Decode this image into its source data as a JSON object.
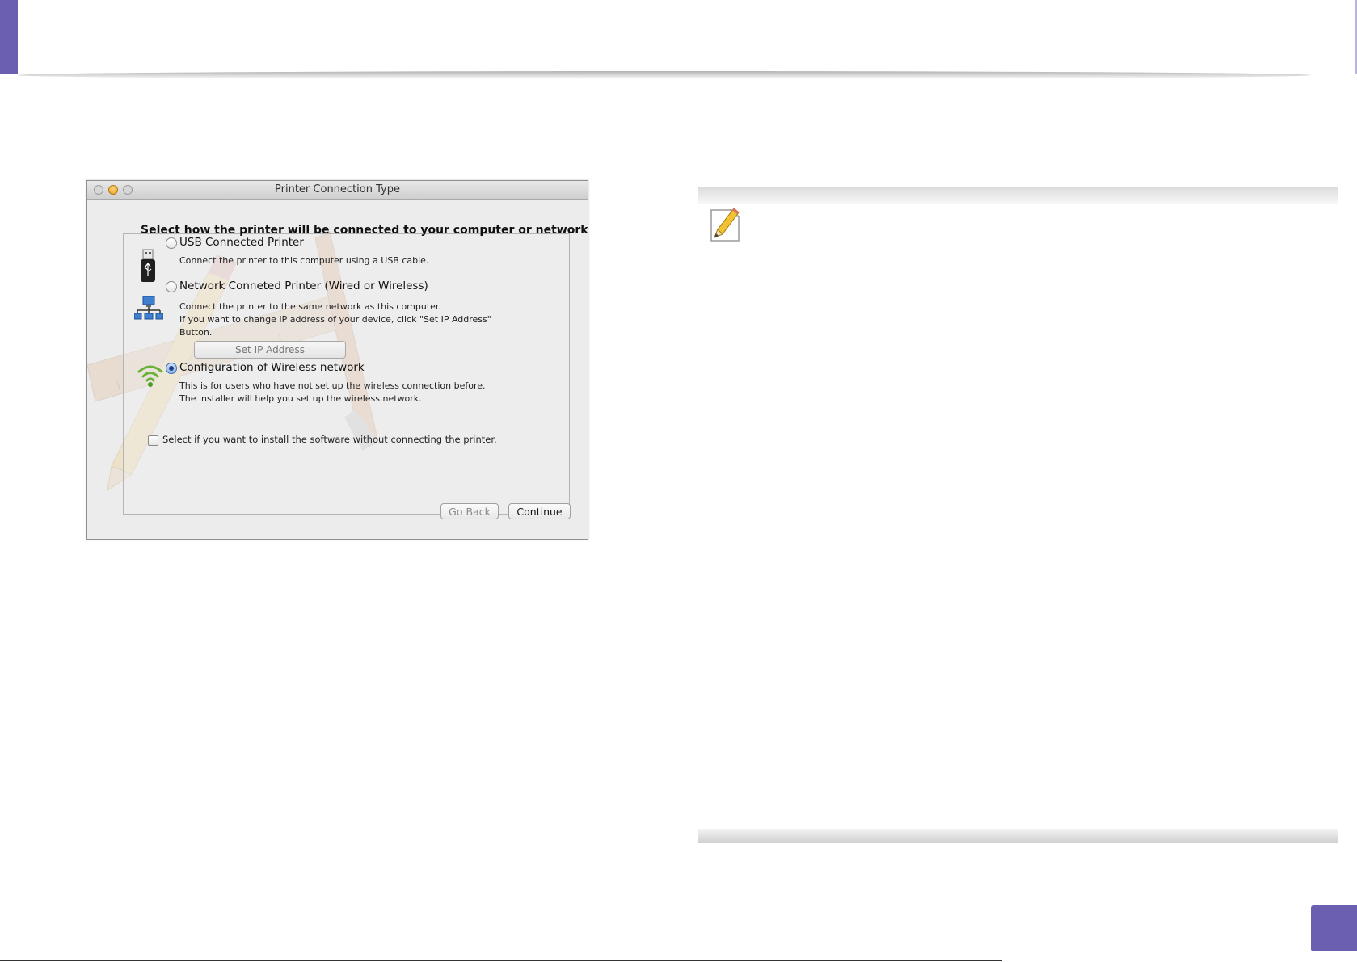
{
  "dialog": {
    "title": "Printer Connection Type",
    "heading": "Select how the printer will be connected to your computer or network.",
    "options": [
      {
        "label": "USB Connected Printer",
        "description": [
          "Connect the printer to this computer using a USB cable."
        ],
        "selected": false,
        "icon": "usb-icon"
      },
      {
        "label": "Network Conneted Printer (Wired or Wireless)",
        "description": [
          "Connect the printer to the same network as this computer.",
          "If you want to change IP address of your device, click \"Set IP Address\"",
          "Button."
        ],
        "selected": false,
        "icon": "network-icon"
      },
      {
        "label": "Configuration of Wireless network",
        "description": [
          "This is for users who have not set up the wireless connection before.",
          "The installer will help you set up the wireless network."
        ],
        "selected": true,
        "icon": "wifi-icon"
      }
    ],
    "set_ip_button": "Set IP Address",
    "checkbox_label": "Select if you want to install the software without connecting the printer.",
    "checkbox_checked": false,
    "go_back_label": "Go Back",
    "continue_label": "Continue"
  },
  "note": {
    "icon": "note-pencil-icon"
  },
  "colors": {
    "accent": "#6a5fb0",
    "radio_selected": "#1e3f80"
  }
}
